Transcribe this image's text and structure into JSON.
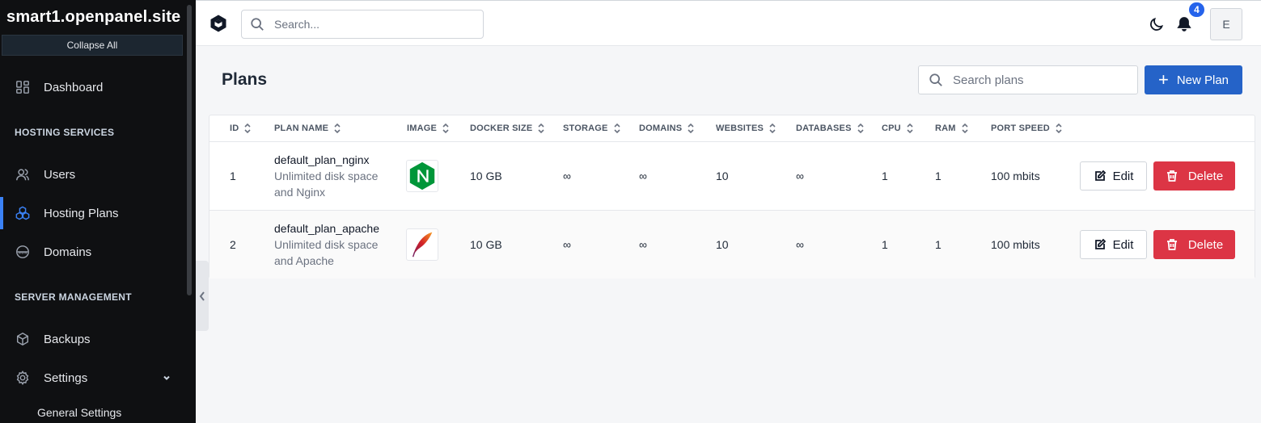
{
  "sidebar": {
    "site_title": "smart1.openpanel.site",
    "collapse_all": "Collapse All",
    "dashboard": "Dashboard",
    "section_hosting": "HOSTING SERVICES",
    "users": "Users",
    "hosting_plans": "Hosting Plans",
    "domains": "Domains",
    "section_server": "SERVER MANAGEMENT",
    "backups": "Backups",
    "settings": "Settings",
    "general_settings": "General Settings",
    "active_item": "Hosting Plans"
  },
  "topbar": {
    "search_placeholder": "Search...",
    "notification_count": "4",
    "avatar_initial": "E"
  },
  "page": {
    "title": "Plans",
    "search_placeholder": "Search plans",
    "new_plan_label": "New Plan"
  },
  "table": {
    "headers": [
      "ID",
      "PLAN NAME",
      "IMAGE",
      "DOCKER SIZE",
      "STORAGE",
      "DOMAINS",
      "WEBSITES",
      "DATABASES",
      "CPU",
      "RAM",
      "PORT SPEED"
    ],
    "rows": [
      {
        "id": "1",
        "name": "default_plan_nginx",
        "desc": "Unlimited disk space and Nginx",
        "image": "nginx-logo",
        "docker_size": "10 GB",
        "storage": "∞",
        "domains": "∞",
        "websites": "10",
        "databases": "∞",
        "cpu": "1",
        "ram": "1",
        "port_speed": "100 mbits",
        "edit": "Edit",
        "delete": "Delete"
      },
      {
        "id": "2",
        "name": "default_plan_apache",
        "desc": "Unlimited disk space and Apache",
        "image": "apache-feather-logo",
        "docker_size": "10 GB",
        "storage": "∞",
        "domains": "∞",
        "websites": "10",
        "databases": "∞",
        "cpu": "1",
        "ram": "1",
        "port_speed": "100 mbits",
        "edit": "Edit",
        "delete": "Delete"
      }
    ]
  },
  "colors": {
    "accent": "#2563c8",
    "danger": "#dc3545",
    "sidebar_bg": "#0f1012"
  }
}
